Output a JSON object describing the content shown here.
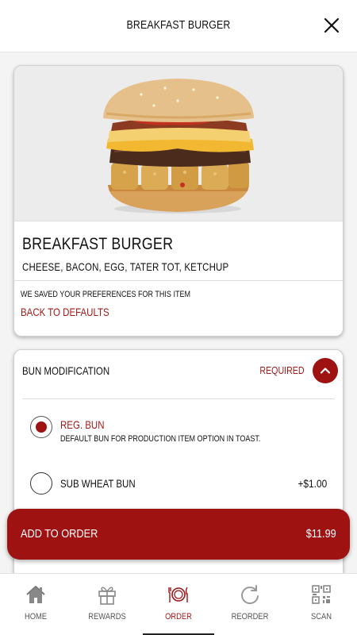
{
  "header": {
    "title": "BREAKFAST BURGER"
  },
  "item": {
    "title": "BREAKFAST BURGER",
    "description": "CHEESE, BACON, EGG, TATER TOT, KETCHUP",
    "preference_note": "WE SAVED YOUR PREFERENCES FOR THIS ITEM",
    "back_to_defaults": "BACK TO DEFAULTS"
  },
  "modification": {
    "title": "BUN MODIFICATION",
    "required": "REQUIRED",
    "options": [
      {
        "name": "REG. BUN",
        "description": "DEFAULT BUN FOR PRODUCTION ITEM OPTION IN TOAST.",
        "price": "",
        "selected": true
      },
      {
        "name": "SUB WHEAT BUN",
        "description": "",
        "price": "+$1.00",
        "selected": false
      }
    ]
  },
  "add_to_order": {
    "label": "ADD TO ORDER",
    "price": "$11.99"
  },
  "nav": {
    "items": [
      {
        "label": "HOME",
        "icon": "home-icon"
      },
      {
        "label": "REWARDS",
        "icon": "gift-icon"
      },
      {
        "label": "ORDER",
        "icon": "plate-utensils-icon",
        "active": true
      },
      {
        "label": "REORDER",
        "icon": "refresh-icon"
      },
      {
        "label": "SCAN",
        "icon": "qr-code-icon"
      }
    ]
  },
  "colors": {
    "accent": "#9e1212",
    "background": "#f4f4f4"
  }
}
